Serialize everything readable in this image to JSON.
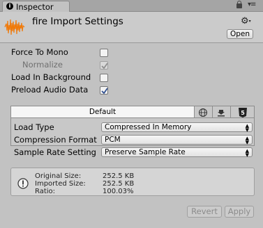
{
  "window": {
    "tab_title": "Inspector",
    "header_title": "fire Import Settings",
    "open_label": "Open"
  },
  "properties": {
    "force_to_mono": {
      "label": "Force To Mono",
      "checked": false
    },
    "normalize": {
      "label": "Normalize",
      "checked": true,
      "disabled": true
    },
    "load_in_background": {
      "label": "Load In Background",
      "checked": false
    },
    "preload_audio_data": {
      "label": "Preload Audio Data",
      "checked": true
    }
  },
  "platform": {
    "default_tab": "Default",
    "platform_icons": [
      "globe-icon",
      "download-icon",
      "html5-icon"
    ]
  },
  "settings": {
    "load_type": {
      "label": "Load Type",
      "value": "Compressed In Memory"
    },
    "compression_format": {
      "label": "Compression Format",
      "value": "PCM"
    },
    "sample_rate_setting": {
      "label": "Sample Rate Setting",
      "value": "Preserve Sample Rate"
    }
  },
  "info": {
    "original_size_label": "Original Size:",
    "original_size_value": "252.5 KB",
    "imported_size_label": "Imported Size:",
    "imported_size_value": "252.5 KB",
    "ratio_label": "Ratio:",
    "ratio_value": "100.03%"
  },
  "buttons": {
    "revert": "Revert",
    "apply": "Apply"
  },
  "colors": {
    "panel_bg": "#c2c2c2",
    "checkmark": "#2f4f8f",
    "waveform": "#f07a0a"
  }
}
